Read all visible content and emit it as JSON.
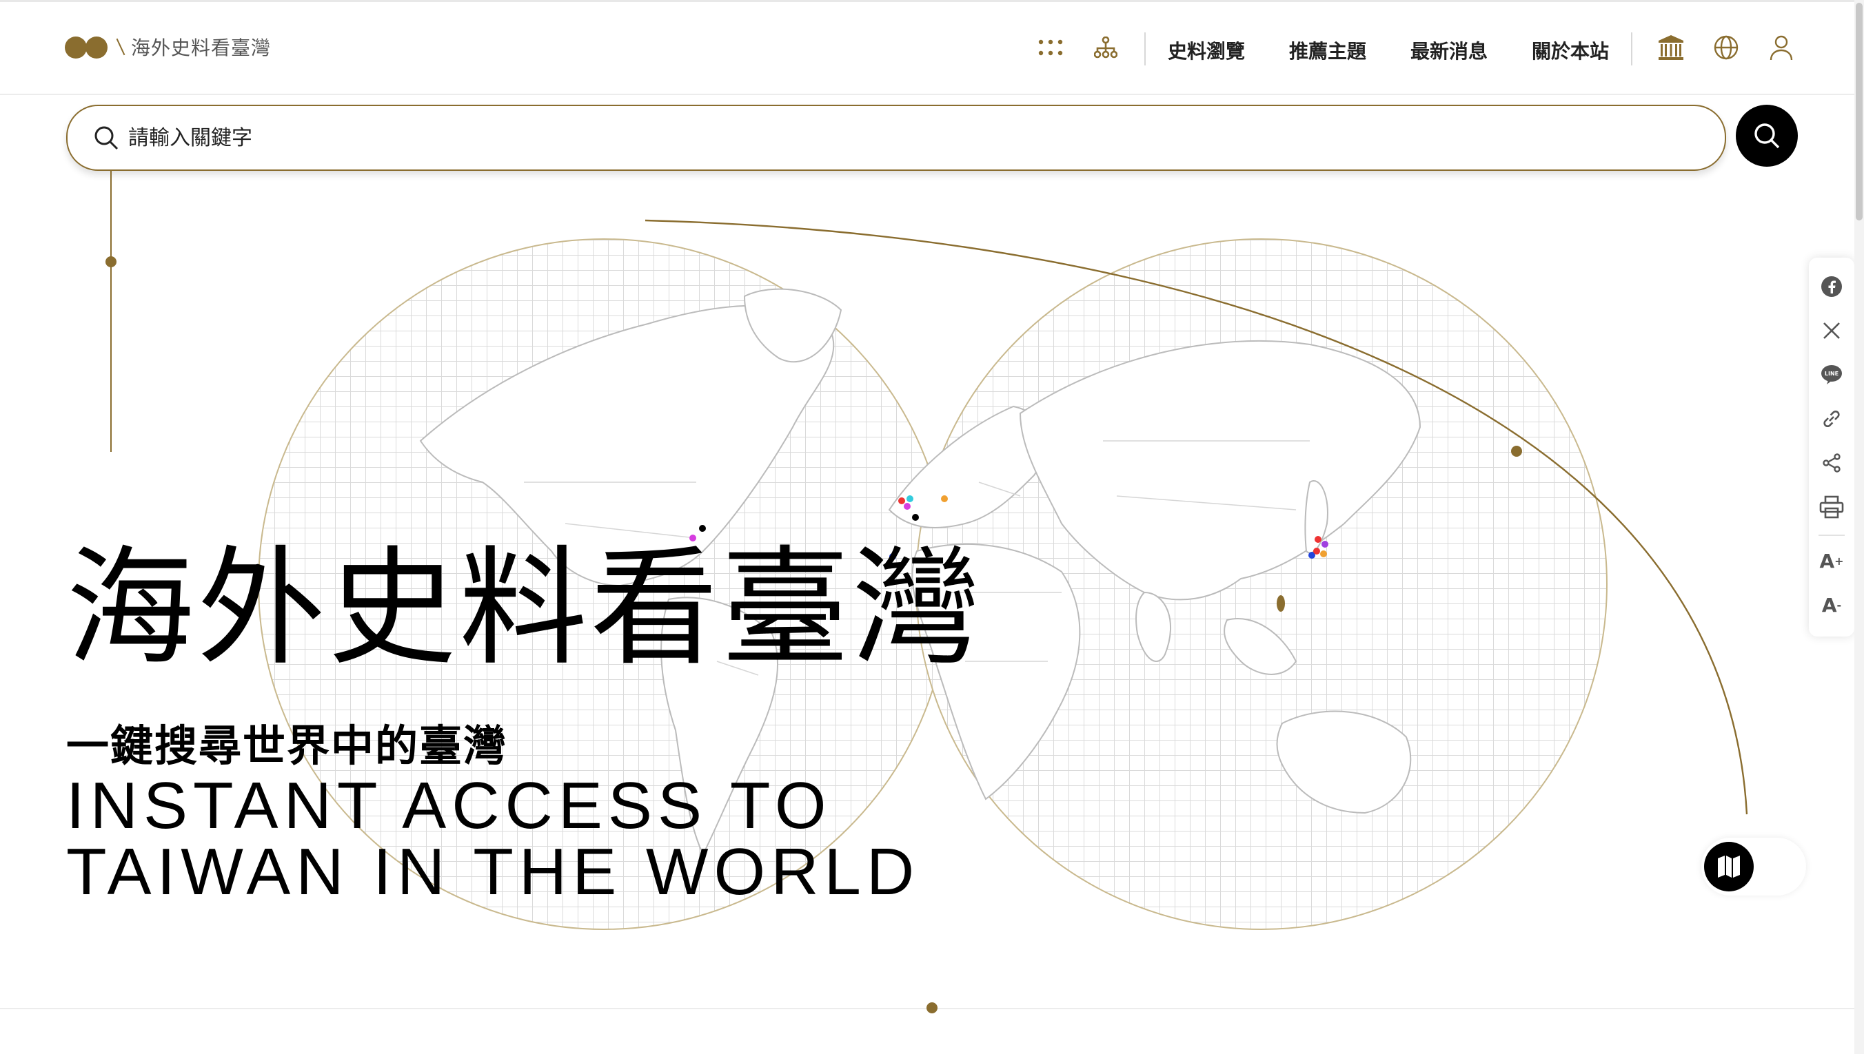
{
  "header": {
    "logo_text": "海外史料看臺灣",
    "nav": [
      "史料瀏覽",
      "推薦主題",
      "最新消息",
      "關於本站"
    ],
    "icons": [
      "grid-dots-icon",
      "sitemap-icon",
      "museum-icon",
      "globe-icon",
      "user-icon"
    ]
  },
  "search": {
    "placeholder": "請輸入關鍵字"
  },
  "hero": {
    "title": "海外史料看臺灣",
    "subtitle": "一鍵搜尋世界中的臺灣",
    "en_line1": "INSTANT ACCESS TO",
    "en_line2": "TAIWAN IN THE WORLD"
  },
  "share": {
    "font_increase": "A",
    "font_increase_sup": "+",
    "font_decrease": "A",
    "font_decrease_sup": "-"
  },
  "colors": {
    "accent": "#8a6d2f",
    "grid": "#dadada",
    "globe_border": "#c9b98e"
  }
}
